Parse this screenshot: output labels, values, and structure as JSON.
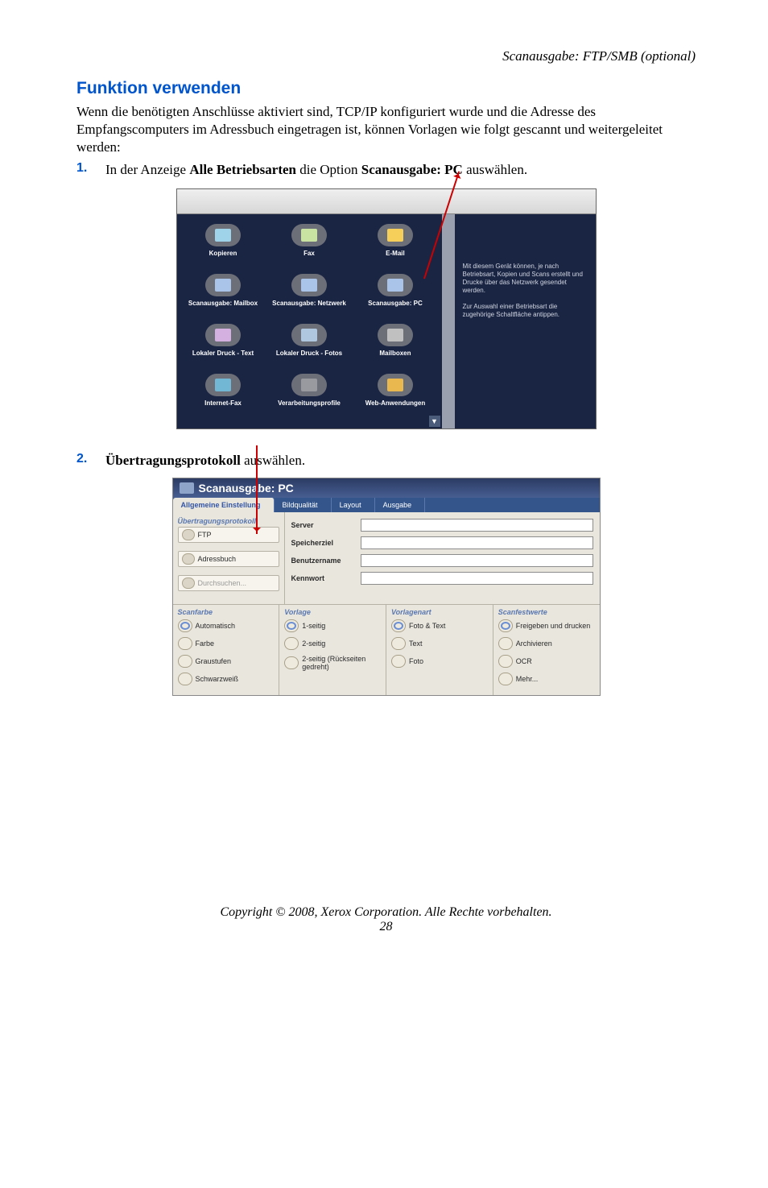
{
  "running_head": "Scanausgabe: FTP/SMB (optional)",
  "section_title": "Funktion verwenden",
  "intro": "Wenn die benötigten Anschlüsse aktiviert sind, TCP/IP konfiguriert wurde und die Adresse des Empfangscomputers im Adressbuch eingetragen ist, können Vorlagen wie folgt gescannt und weitergeleitet werden:",
  "steps": [
    {
      "num": "1.",
      "pre": "In der Anzeige ",
      "bold1": "Alle Betriebsarten",
      "mid": " die Option ",
      "bold2": "Scanausgabe: PC",
      "post": " auswählen."
    },
    {
      "num": "2.",
      "bold1": "Übertragungsprotokoll",
      "post": " auswählen."
    }
  ],
  "services_screen": {
    "items": [
      [
        "Kopieren",
        "Fax",
        "E-Mail"
      ],
      [
        "Scanausgabe: Mailbox",
        "Scanausgabe: Netzwerk",
        "Scanausgabe: PC"
      ],
      [
        "Lokaler Druck - Text",
        "Lokaler Druck - Fotos",
        "Mailboxen"
      ],
      [
        "Internet-Fax",
        "Verarbeitungsprofile",
        "Web-Anwendungen"
      ]
    ],
    "info1": "Mit diesem Gerät können, je nach Betriebsart, Kopien und Scans erstellt und Drucke über das Netzwerk gesendet werden.",
    "info2": "Zur Auswahl einer Betriebsart die zugehörige Schaltfläche antippen."
  },
  "scanpc_screen": {
    "title": "Scanausgabe: PC",
    "tabs": [
      "Allgemeine Einstellung",
      "Bildqualität",
      "Layout",
      "Ausgabe"
    ],
    "left_head": "Übertragungsprotokoll",
    "left_buttons": [
      "FTP",
      "Adressbuch",
      "Durchsuchen..."
    ],
    "form_labels": [
      "Server",
      "Speicherziel",
      "Benutzername",
      "Kennwort"
    ],
    "cols": {
      "Scanfarbe": [
        "Automatisch",
        "Farbe",
        "Graustufen",
        "Schwarzweiß"
      ],
      "Vorlage": [
        "1-seitig",
        "2-seitig",
        "2-seitig (Rückseiten gedreht)"
      ],
      "Vorlagenart": [
        "Foto & Text",
        "Text",
        "Foto"
      ],
      "Scanfestwerte": [
        "Freigeben und drucken",
        "Archivieren",
        "OCR",
        "Mehr..."
      ]
    },
    "selected": {
      "Scanfarbe": 0,
      "Vorlage": 0,
      "Vorlagenart": 0,
      "Scanfestwerte": 0
    }
  },
  "footer": "Copyright © 2008, Xerox Corporation. Alle Rechte vorbehalten.",
  "page_number": "28"
}
